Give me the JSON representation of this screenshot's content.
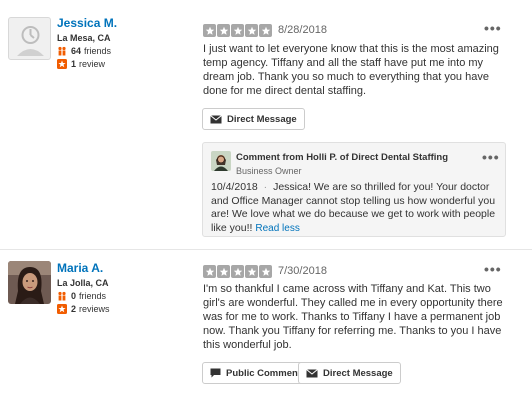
{
  "reviews": [
    {
      "user": {
        "name": "Jessica M.",
        "location": "La Mesa, CA",
        "friends": "64",
        "friends_label": "friends",
        "reviews": "1",
        "reviews_label": "review"
      },
      "rating": 5,
      "date": "8/28/2018",
      "text": "I just want to let everyone know that this is the most amazing temp agency. Tiffany  and all the staff have put me into my dream job. Thank you so much to everything that you have done for me direct dental staffing.",
      "actions": {
        "direct_message": "Direct Message"
      },
      "owner_comment": {
        "title": "Comment from Holli P. of Direct Dental Staffing",
        "role": "Business Owner",
        "date": "10/4/2018",
        "separator": "·",
        "text": "Jessica!  We are so thrilled for you!  Your doctor and Office Manager cannot stop telling us how wonderful you are!  We love what we do because we get to work with people like you!!",
        "read_less": "Read less"
      }
    },
    {
      "user": {
        "name": "Maria A.",
        "location": "La Jolla, CA",
        "friends": "0",
        "friends_label": "friends",
        "reviews": "2",
        "reviews_label": "reviews"
      },
      "rating": 5,
      "date": "7/30/2018",
      "text": "I'm so thankful I came across with Tiffany and Kat. This two girl's are wonderful. They called me in every opportunity there was for me to work. Thanks to Tiffany I have a permanent job now. Thank you Tiffany for referring me. Thanks to you I have this wonderful job.",
      "actions": {
        "public_comment": "Public Comment",
        "direct_message": "Direct Message"
      }
    }
  ],
  "colors": {
    "link": "#0073bb",
    "star_gray": "#a7a7a7",
    "friends_icon": "#f15c00",
    "review_icon": "#f15c00"
  },
  "icons": {
    "more": "more-options-icon",
    "message": "envelope-icon",
    "comment": "speech-bubble-icon"
  }
}
